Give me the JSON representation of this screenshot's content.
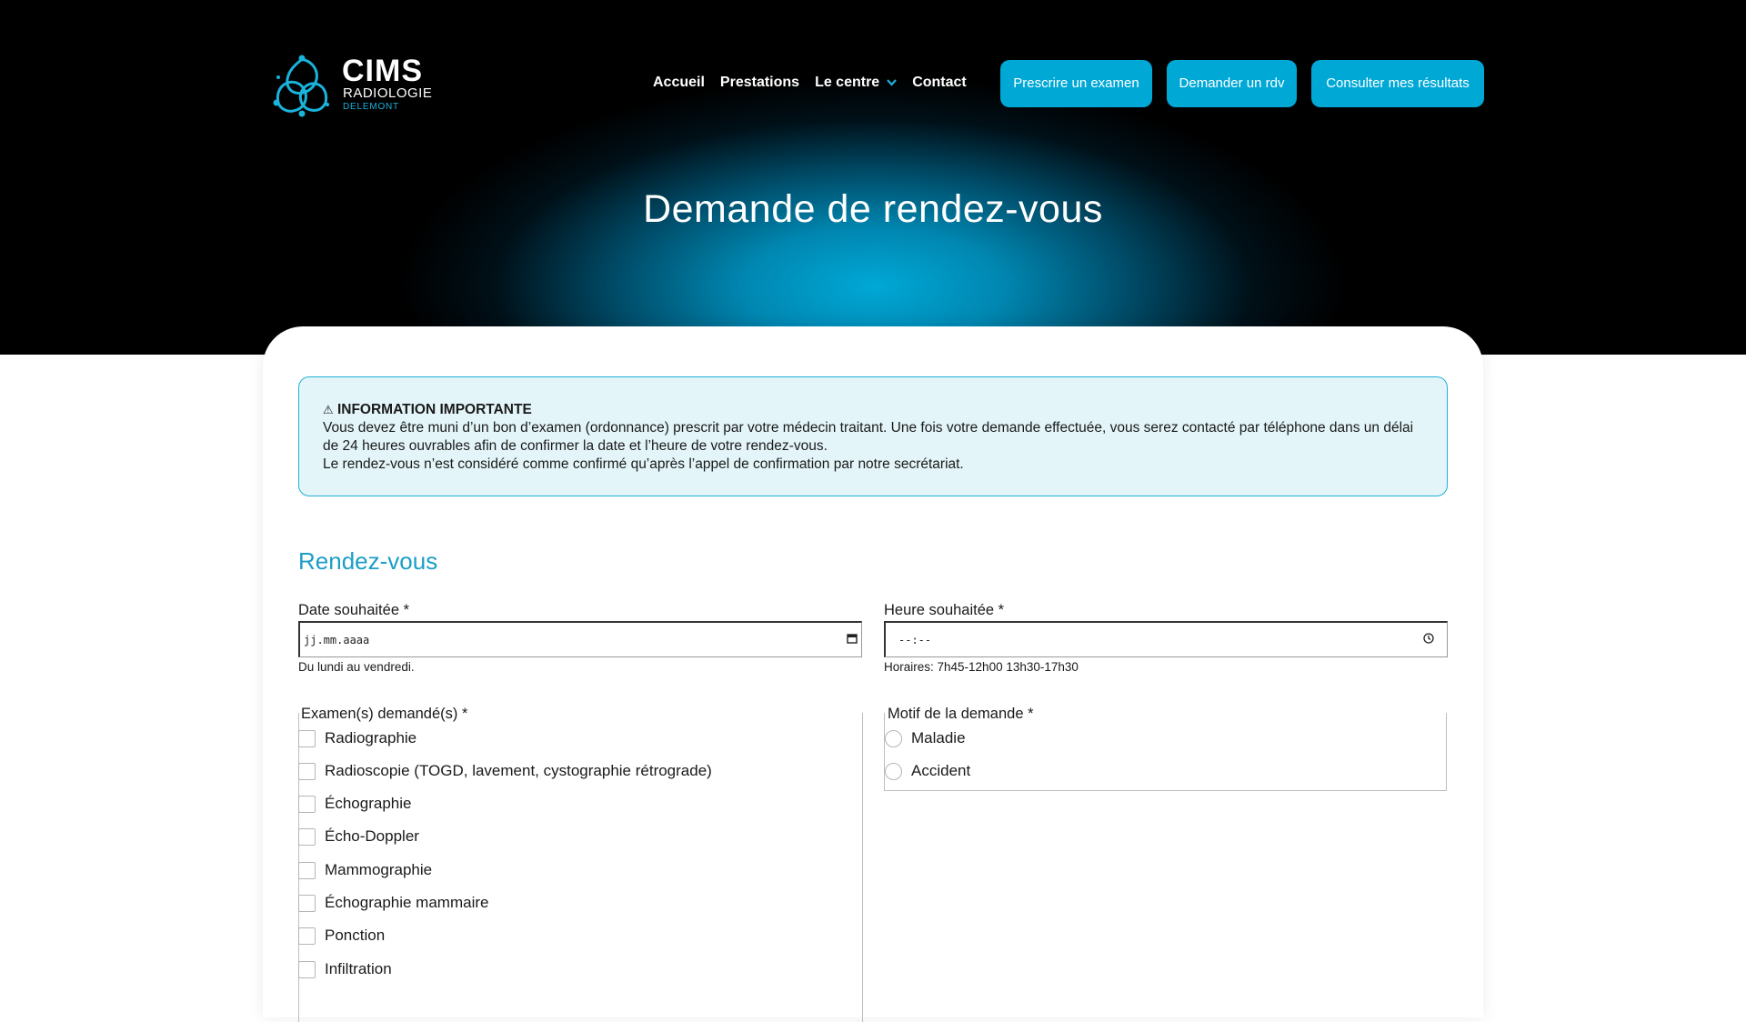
{
  "brand": {
    "name": "CIMS",
    "subtitle": "RADIOLOGIE",
    "city": "DELEMONT"
  },
  "nav": {
    "items": [
      "Accueil",
      "Prestations",
      "Le centre",
      "Contact"
    ],
    "chevron": "chevron-down-icon"
  },
  "cta": {
    "prescrire": "Prescrire un examen",
    "demander": "Demander un rdv",
    "consulter": "Consulter mes résultats"
  },
  "page_title": "Demande de rendez-vous",
  "info": {
    "icon": "warning-icon",
    "icon_glyph": "⚠",
    "heading": "INFORMATION IMPORTANTE",
    "line1": "Vous devez être muni d’un bon d’examen (ordonnance) prescrit par votre médecin traitant. Une fois votre demande effectuée, vous serez contacté par téléphone dans un délai de 24 heures ouvrables afin de confirmer la date et l’heure de votre rendez-vous.",
    "line2": "Le rendez-vous n’est considéré comme confirmé qu’après l’appel de confirmation par notre  secrétariat."
  },
  "section": {
    "title": "Rendez-vous"
  },
  "date": {
    "label": "Date souhaitée *",
    "placeholder": "jj.mm.aaaa",
    "help": "Du lundi au vendredi."
  },
  "time": {
    "label": "Heure souhaitée *",
    "placeholder": "--:--",
    "help": "Horaires: 7h45-12h00 13h30-17h30"
  },
  "exams": {
    "legend": "Examen(s) demandé(s) *",
    "options": [
      "Radiographie",
      "Radioscopie (TOGD, lavement, cystographie rétrograde)",
      "Échographie",
      "Écho-Doppler",
      "Mammographie",
      "Échographie mammaire",
      "Ponction",
      "Infiltration"
    ]
  },
  "motif": {
    "legend": "Motif de la demande *",
    "options": [
      "Maladie",
      "Accident"
    ]
  },
  "colors": {
    "accent": "#00a8d6",
    "title_blue": "#1b9ec7",
    "info_bg": "#e3f5f9"
  }
}
